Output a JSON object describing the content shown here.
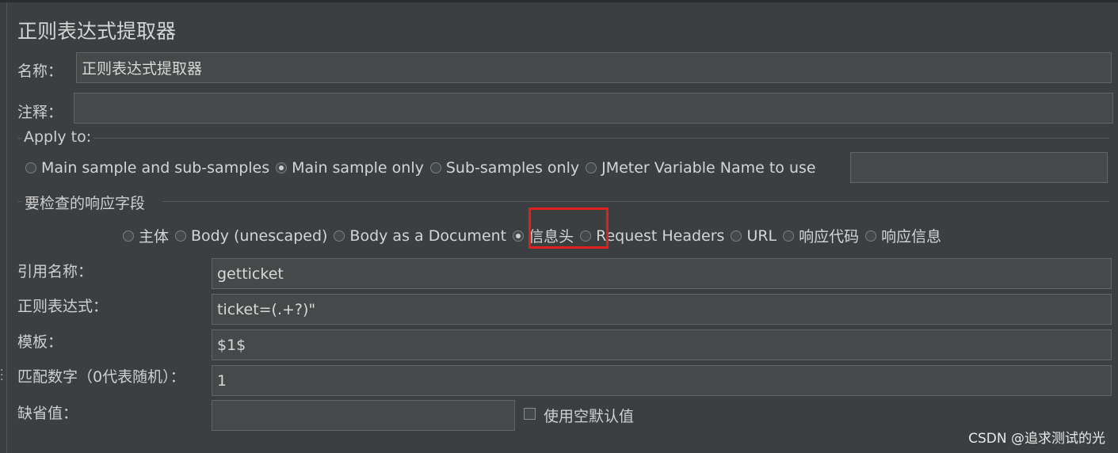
{
  "panel_title": "正则表达式提取器",
  "name": {
    "label": "名称：",
    "value": "正则表达式提取器"
  },
  "comment": {
    "label": "注释：",
    "value": ""
  },
  "apply_to": {
    "legend": "Apply to:",
    "options": [
      "Main sample and sub-samples",
      "Main sample only",
      "Sub-samples only",
      "JMeter Variable Name to use"
    ],
    "selected": "Main sample only",
    "variable_value": ""
  },
  "response_field": {
    "legend": "要检查的响应字段",
    "options": [
      "主体",
      "Body (unescaped)",
      "Body as a Document",
      "信息头",
      "Request Headers",
      "URL",
      "响应代码",
      "响应信息"
    ],
    "selected": "信息头",
    "highlight_color": "#e1201c"
  },
  "ref_name": {
    "label": "引用名称：",
    "value": "getticket"
  },
  "regex": {
    "label": "正则表达式：",
    "value": "ticket=(.+?)\""
  },
  "template": {
    "label": "模板：",
    "value": "$1$"
  },
  "match_no": {
    "label": "匹配数字（0代表随机）：",
    "value": "1"
  },
  "default_value": {
    "label": "缺省值：",
    "value": "",
    "empty_default_label": "使用空默认值",
    "empty_default_checked": false
  },
  "watermark": "CSDN @追求测试的光",
  "colors": {
    "background": "#3c3f41",
    "field": "#45494a",
    "text": "#d0d0d0"
  }
}
